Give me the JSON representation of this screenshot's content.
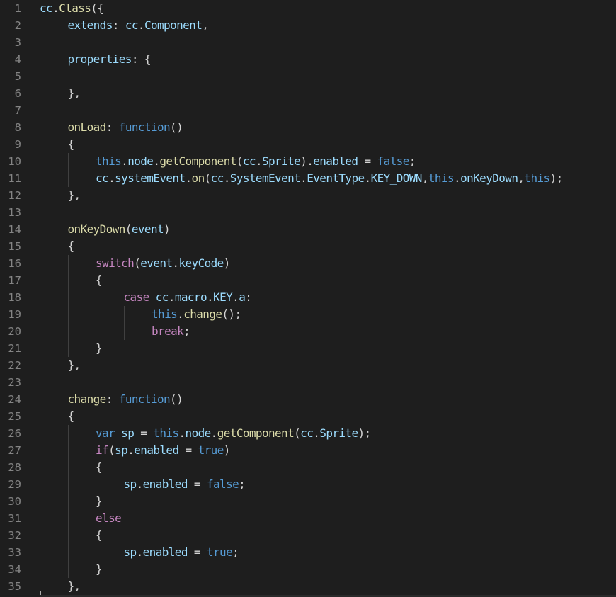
{
  "editor": {
    "colors": {
      "background": "#1e1e1e",
      "line_number": "#858585",
      "identifier": "#9cdcfe",
      "function": "#dcdcaa",
      "keyword": "#569cd6",
      "control": "#c586c0",
      "punctuation": "#d4d4d4"
    },
    "lines": [
      {
        "n": "1",
        "indent": 0,
        "tokens": [
          [
            "id",
            "cc"
          ],
          [
            "p",
            "."
          ],
          [
            "fn",
            "Class"
          ],
          [
            "p",
            "({"
          ]
        ]
      },
      {
        "n": "2",
        "indent": 1,
        "tokens": [
          [
            "id",
            "extends"
          ],
          [
            "p",
            ": "
          ],
          [
            "id",
            "cc"
          ],
          [
            "p",
            "."
          ],
          [
            "id",
            "Component"
          ],
          [
            "p",
            ","
          ]
        ]
      },
      {
        "n": "3",
        "indent": 0,
        "tokens": []
      },
      {
        "n": "4",
        "indent": 1,
        "tokens": [
          [
            "id",
            "properties"
          ],
          [
            "p",
            ": {"
          ]
        ]
      },
      {
        "n": "5",
        "indent": 0,
        "tokens": []
      },
      {
        "n": "6",
        "indent": 1,
        "tokens": [
          [
            "p",
            "},"
          ]
        ]
      },
      {
        "n": "7",
        "indent": 0,
        "tokens": []
      },
      {
        "n": "8",
        "indent": 1,
        "tokens": [
          [
            "fn",
            "onLoad"
          ],
          [
            "p",
            ": "
          ],
          [
            "kw",
            "function"
          ],
          [
            "p",
            "()"
          ]
        ]
      },
      {
        "n": "9",
        "indent": 1,
        "tokens": [
          [
            "p",
            "{"
          ]
        ]
      },
      {
        "n": "10",
        "indent": 2,
        "tokens": [
          [
            "kw",
            "this"
          ],
          [
            "p",
            "."
          ],
          [
            "id",
            "node"
          ],
          [
            "p",
            "."
          ],
          [
            "fn",
            "getComponent"
          ],
          [
            "p",
            "("
          ],
          [
            "id",
            "cc"
          ],
          [
            "p",
            "."
          ],
          [
            "id",
            "Sprite"
          ],
          [
            "p",
            ")."
          ],
          [
            "id",
            "enabled"
          ],
          [
            "p",
            " = "
          ],
          [
            "kw",
            "false"
          ],
          [
            "p",
            ";"
          ]
        ]
      },
      {
        "n": "11",
        "indent": 2,
        "tokens": [
          [
            "id",
            "cc"
          ],
          [
            "p",
            "."
          ],
          [
            "id",
            "systemEvent"
          ],
          [
            "p",
            "."
          ],
          [
            "fn",
            "on"
          ],
          [
            "p",
            "("
          ],
          [
            "id",
            "cc"
          ],
          [
            "p",
            "."
          ],
          [
            "id",
            "SystemEvent"
          ],
          [
            "p",
            "."
          ],
          [
            "id",
            "EventType"
          ],
          [
            "p",
            "."
          ],
          [
            "id",
            "KEY_DOWN"
          ],
          [
            "p",
            ","
          ],
          [
            "kw",
            "this"
          ],
          [
            "p",
            "."
          ],
          [
            "id",
            "onKeyDown"
          ],
          [
            "p",
            ","
          ],
          [
            "kw",
            "this"
          ],
          [
            "p",
            ");"
          ]
        ]
      },
      {
        "n": "12",
        "indent": 1,
        "tokens": [
          [
            "p",
            "},"
          ]
        ]
      },
      {
        "n": "13",
        "indent": 0,
        "tokens": []
      },
      {
        "n": "14",
        "indent": 1,
        "tokens": [
          [
            "fn",
            "onKeyDown"
          ],
          [
            "p",
            "("
          ],
          [
            "id",
            "event"
          ],
          [
            "p",
            ")"
          ]
        ]
      },
      {
        "n": "15",
        "indent": 1,
        "tokens": [
          [
            "p",
            "{"
          ]
        ]
      },
      {
        "n": "16",
        "indent": 2,
        "tokens": [
          [
            "ctl",
            "switch"
          ],
          [
            "p",
            "("
          ],
          [
            "id",
            "event"
          ],
          [
            "p",
            "."
          ],
          [
            "id",
            "keyCode"
          ],
          [
            "p",
            ")"
          ]
        ]
      },
      {
        "n": "17",
        "indent": 2,
        "tokens": [
          [
            "p",
            "{"
          ]
        ]
      },
      {
        "n": "18",
        "indent": 3,
        "tokens": [
          [
            "ctl",
            "case"
          ],
          [
            "p",
            " "
          ],
          [
            "id",
            "cc"
          ],
          [
            "p",
            "."
          ],
          [
            "id",
            "macro"
          ],
          [
            "p",
            "."
          ],
          [
            "id",
            "KEY"
          ],
          [
            "p",
            "."
          ],
          [
            "id",
            "a"
          ],
          [
            "p",
            ":"
          ]
        ]
      },
      {
        "n": "19",
        "indent": 4,
        "tokens": [
          [
            "kw",
            "this"
          ],
          [
            "p",
            "."
          ],
          [
            "fn",
            "change"
          ],
          [
            "p",
            "();"
          ]
        ]
      },
      {
        "n": "20",
        "indent": 4,
        "tokens": [
          [
            "ctl",
            "break"
          ],
          [
            "p",
            ";"
          ]
        ]
      },
      {
        "n": "21",
        "indent": 2,
        "tokens": [
          [
            "p",
            "}"
          ]
        ]
      },
      {
        "n": "22",
        "indent": 1,
        "tokens": [
          [
            "p",
            "},"
          ]
        ]
      },
      {
        "n": "23",
        "indent": 0,
        "tokens": []
      },
      {
        "n": "24",
        "indent": 1,
        "tokens": [
          [
            "fn",
            "change"
          ],
          [
            "p",
            ": "
          ],
          [
            "kw",
            "function"
          ],
          [
            "p",
            "()"
          ]
        ]
      },
      {
        "n": "25",
        "indent": 1,
        "tokens": [
          [
            "p",
            "{"
          ]
        ]
      },
      {
        "n": "26",
        "indent": 2,
        "tokens": [
          [
            "kw",
            "var"
          ],
          [
            "p",
            " "
          ],
          [
            "id",
            "sp"
          ],
          [
            "p",
            " = "
          ],
          [
            "kw",
            "this"
          ],
          [
            "p",
            "."
          ],
          [
            "id",
            "node"
          ],
          [
            "p",
            "."
          ],
          [
            "fn",
            "getComponent"
          ],
          [
            "p",
            "("
          ],
          [
            "id",
            "cc"
          ],
          [
            "p",
            "."
          ],
          [
            "id",
            "Sprite"
          ],
          [
            "p",
            ");"
          ]
        ]
      },
      {
        "n": "27",
        "indent": 2,
        "tokens": [
          [
            "ctl",
            "if"
          ],
          [
            "p",
            "("
          ],
          [
            "id",
            "sp"
          ],
          [
            "p",
            "."
          ],
          [
            "id",
            "enabled"
          ],
          [
            "p",
            " = "
          ],
          [
            "kw",
            "true"
          ],
          [
            "p",
            ")"
          ]
        ]
      },
      {
        "n": "28",
        "indent": 2,
        "tokens": [
          [
            "p",
            "{"
          ]
        ]
      },
      {
        "n": "29",
        "indent": 3,
        "tokens": [
          [
            "id",
            "sp"
          ],
          [
            "p",
            "."
          ],
          [
            "id",
            "enabled"
          ],
          [
            "p",
            " = "
          ],
          [
            "kw",
            "false"
          ],
          [
            "p",
            ";"
          ]
        ]
      },
      {
        "n": "30",
        "indent": 2,
        "tokens": [
          [
            "p",
            "}"
          ]
        ]
      },
      {
        "n": "31",
        "indent": 2,
        "tokens": [
          [
            "ctl",
            "else"
          ]
        ]
      },
      {
        "n": "32",
        "indent": 2,
        "tokens": [
          [
            "p",
            "{"
          ]
        ]
      },
      {
        "n": "33",
        "indent": 3,
        "tokens": [
          [
            "id",
            "sp"
          ],
          [
            "p",
            "."
          ],
          [
            "id",
            "enabled"
          ],
          [
            "p",
            " = "
          ],
          [
            "kw",
            "true"
          ],
          [
            "p",
            ";"
          ]
        ]
      },
      {
        "n": "34",
        "indent": 2,
        "tokens": [
          [
            "p",
            "}"
          ]
        ]
      },
      {
        "n": "35",
        "indent": 1,
        "tokens": [
          [
            "p",
            "},"
          ]
        ]
      }
    ],
    "guides": [
      {
        "from": "2",
        "to": "35",
        "level": 0
      },
      {
        "from": "10",
        "to": "11",
        "level": 1
      },
      {
        "from": "16",
        "to": "21",
        "level": 1
      },
      {
        "from": "18",
        "to": "20",
        "level": 2
      },
      {
        "from": "19",
        "to": "20",
        "level": 3
      },
      {
        "from": "26",
        "to": "34",
        "level": 1
      },
      {
        "from": "29",
        "to": "29",
        "level": 2
      },
      {
        "from": "33",
        "to": "33",
        "level": 2
      }
    ]
  }
}
